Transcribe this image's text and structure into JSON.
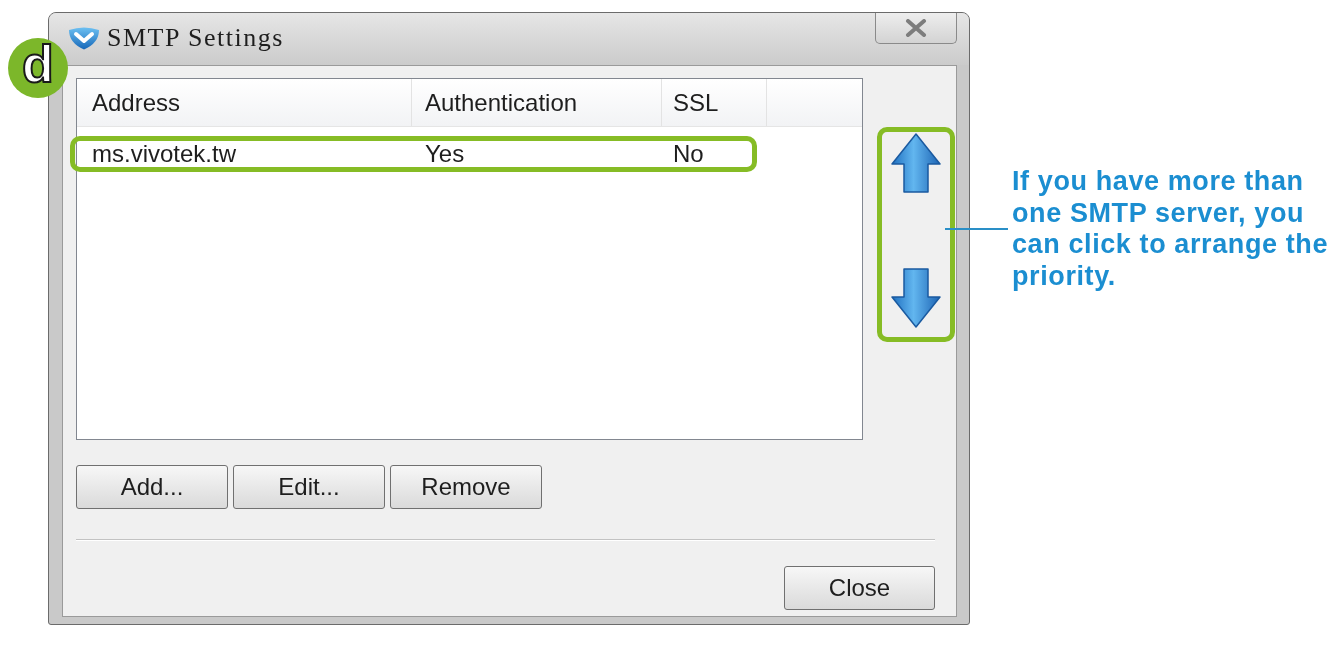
{
  "step_badge": {
    "label": "d"
  },
  "window": {
    "title": "SMTP Settings"
  },
  "table": {
    "columns": [
      "Address",
      "Authentication",
      "SSL"
    ],
    "rows": [
      {
        "cells": [
          "ms.vivotek.tw",
          "Yes",
          "No"
        ],
        "selected": false,
        "highlighted": true
      }
    ]
  },
  "reorder_panel": {
    "highlighted": true
  },
  "buttons": [
    "Add...",
    "Edit...",
    "Remove"
  ],
  "footer_buttons": [
    "Close"
  ],
  "callout": {
    "text": "If you have more than one SMTP server, you can click to arrange the priority."
  }
}
